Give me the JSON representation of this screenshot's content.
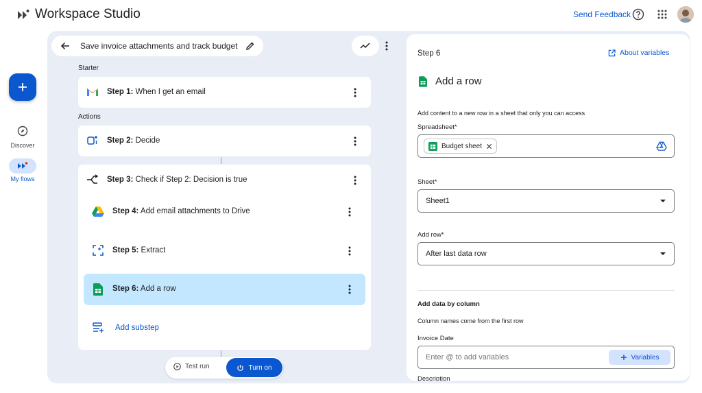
{
  "app": {
    "title": "Workspace Studio"
  },
  "header": {
    "send_feedback": "Send Feedback"
  },
  "left_rail": {
    "create_label": "+",
    "items": [
      {
        "label": "Discover"
      },
      {
        "label": "My flows"
      }
    ]
  },
  "flow": {
    "title": "Save invoice attachments and track budget",
    "starter_label": "Starter",
    "actions_label": "Actions",
    "steps": [
      {
        "prefix": "Step 1:",
        "text": " When I get an email"
      },
      {
        "prefix": "Step 2:",
        "text": " Decide"
      },
      {
        "prefix": "Step 3:",
        "text": " Check if Step 2: Decision is true"
      },
      {
        "prefix": "Step 4:",
        "text": " Add email attachments to Drive"
      },
      {
        "prefix": "Step 5:",
        "text": " Extract"
      },
      {
        "prefix": "Step 6:",
        "text": " Add a row"
      }
    ],
    "add_substep": "Add substep",
    "test_run": "Test run",
    "turn_on": "Turn on"
  },
  "panel": {
    "step_label": "Step 6",
    "about_variables": "About variables",
    "title": "Add a row",
    "description": "Add content to a new row in a sheet that only you can access",
    "spreadsheet_label": "Spreadsheet*",
    "spreadsheet_chip": "Budget sheet",
    "sheet_label": "Sheet*",
    "sheet_value": "Sheet1",
    "add_row_label": "Add row*",
    "add_row_value": "After last data row",
    "add_data_heading": "Add data by column",
    "add_data_desc": "Column names come from the first row",
    "invoice_date_label": "Invoice Date",
    "invoice_date_placeholder": "Enter @ to add variables",
    "variables_button": "Variables",
    "next_label_cut": "Description"
  },
  "colors": {
    "accent": "#0b57d0",
    "canvas_bg": "#e9eef6",
    "selected_bg": "#c2e7ff",
    "chip_bg": "#d3e3fd"
  },
  "icons": [
    "logo-icon",
    "help-icon",
    "apps-icon",
    "avatar",
    "back-arrow-icon",
    "edit-pencil-icon",
    "trend-icon",
    "more-vert-icon",
    "gmail-icon",
    "decide-icon",
    "branch-icon",
    "drive-icon",
    "extract-icon",
    "sheets-icon",
    "add-substep-icon",
    "play-icon",
    "power-icon",
    "open-external-icon",
    "compass-icon",
    "flows-icon",
    "close-icon",
    "dropdown-arrow-icon",
    "plus-icon"
  ]
}
